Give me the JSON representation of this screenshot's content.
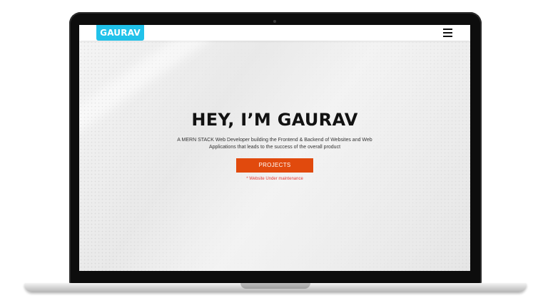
{
  "site": {
    "logo": "GAURAV",
    "menu_icon": "hamburger-menu-icon"
  },
  "hero": {
    "title": "HEY, I’M GAURAV",
    "subtitle": "A MERN STACK Web Developer building the Frontend & Backend of Websites and Web Applications that leads to the success of the overall product",
    "cta_label": "PROJECTS",
    "note": "* Website Under maintenance"
  },
  "colors": {
    "logo_bg": "#21c2ea",
    "cta_bg": "#e14a0d",
    "note_text": "#e53935",
    "title_text": "#121212"
  }
}
